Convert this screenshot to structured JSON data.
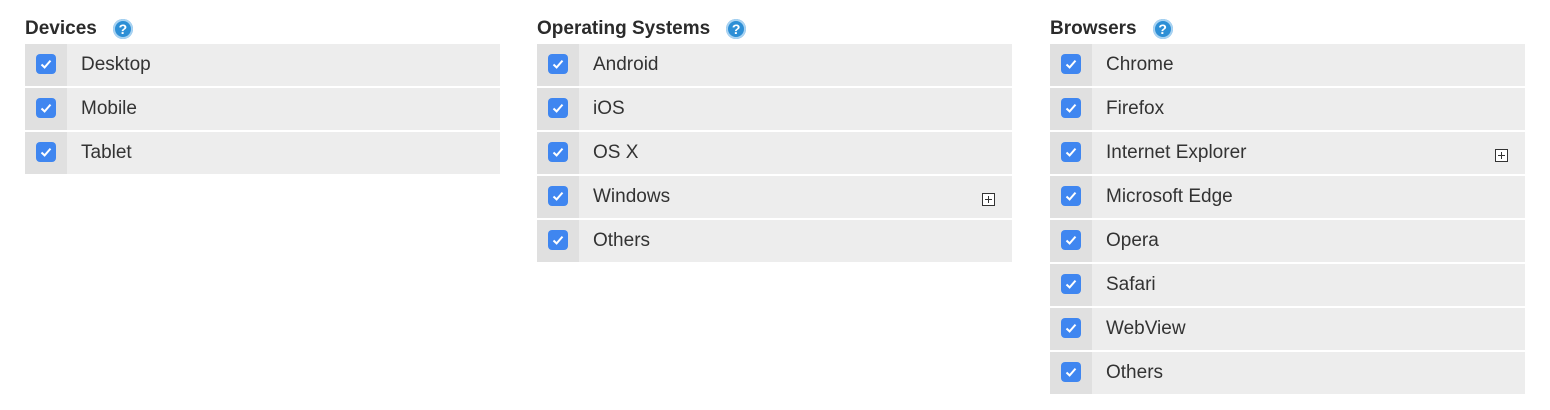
{
  "groups": [
    {
      "title": "Devices",
      "help_icon": "?",
      "items": [
        {
          "label": "Desktop",
          "checked": true,
          "expandable": false
        },
        {
          "label": "Mobile",
          "checked": true,
          "expandable": false
        },
        {
          "label": "Tablet",
          "checked": true,
          "expandable": false
        }
      ]
    },
    {
      "title": "Operating Systems",
      "help_icon": "?",
      "items": [
        {
          "label": "Android",
          "checked": true,
          "expandable": false
        },
        {
          "label": "iOS",
          "checked": true,
          "expandable": false
        },
        {
          "label": "OS X",
          "checked": true,
          "expandable": false
        },
        {
          "label": "Windows",
          "checked": true,
          "expandable": true
        },
        {
          "label": "Others",
          "checked": true,
          "expandable": false
        }
      ]
    },
    {
      "title": "Browsers",
      "help_icon": "?",
      "items": [
        {
          "label": "Chrome",
          "checked": true,
          "expandable": false
        },
        {
          "label": "Firefox",
          "checked": true,
          "expandable": false
        },
        {
          "label": "Internet Explorer",
          "checked": true,
          "expandable": true
        },
        {
          "label": "Microsoft Edge",
          "checked": true,
          "expandable": false
        },
        {
          "label": "Opera",
          "checked": true,
          "expandable": false
        },
        {
          "label": "Safari",
          "checked": true,
          "expandable": false
        },
        {
          "label": "WebView",
          "checked": true,
          "expandable": false
        },
        {
          "label": "Others",
          "checked": true,
          "expandable": false
        }
      ]
    }
  ],
  "colors": {
    "checkbox": "#3f86f0",
    "help_icon": "#2d8fd6",
    "row_bg": "#ededed",
    "check_cell_bg": "#e0e0e0"
  }
}
